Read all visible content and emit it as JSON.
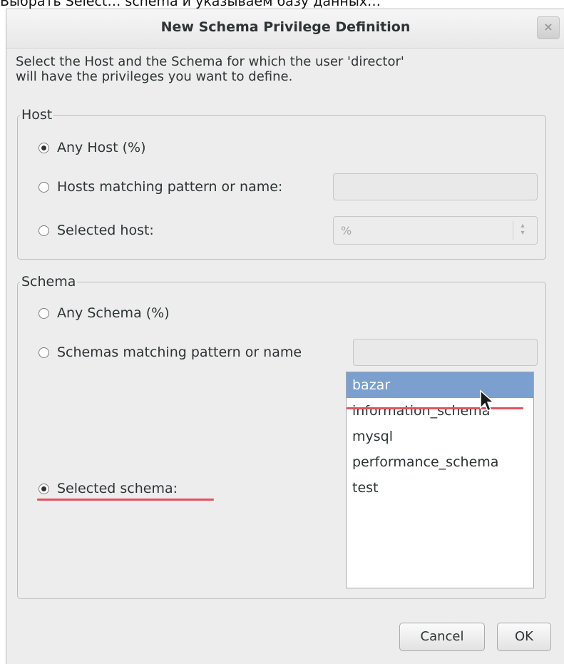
{
  "window": {
    "background_text": "Выбрать Select…  schema и указываем базу данных…",
    "title": "New Schema Privilege Definition",
    "close_symbol": "×"
  },
  "intro": {
    "line1": "Select the Host and the Schema for which the user 'director'",
    "line2": "will have the privileges you want to define."
  },
  "host": {
    "legend": "Host",
    "options": [
      {
        "label": "Any Host (%)",
        "checked": true
      },
      {
        "label": "Hosts matching pattern or name:",
        "checked": false
      },
      {
        "label": "Selected host:",
        "checked": false
      }
    ],
    "pattern_value": "",
    "selected_host_value": "%"
  },
  "schema": {
    "legend": "Schema",
    "options": [
      {
        "label": "Any Schema (%)",
        "checked": false
      },
      {
        "label": "Schemas matching pattern or name",
        "checked": false
      },
      {
        "label": "Selected schema:",
        "checked": true
      }
    ],
    "pattern_value": "",
    "list": [
      "bazar",
      "information_schema",
      "mysql",
      "performance_schema",
      "test"
    ],
    "selected_item": "bazar"
  },
  "buttons": {
    "cancel": "Cancel",
    "ok": "OK"
  },
  "colors": {
    "selection": "#7ba0cf",
    "annotation_underline": "#e4525f",
    "dialog_bg": "#ededed"
  }
}
